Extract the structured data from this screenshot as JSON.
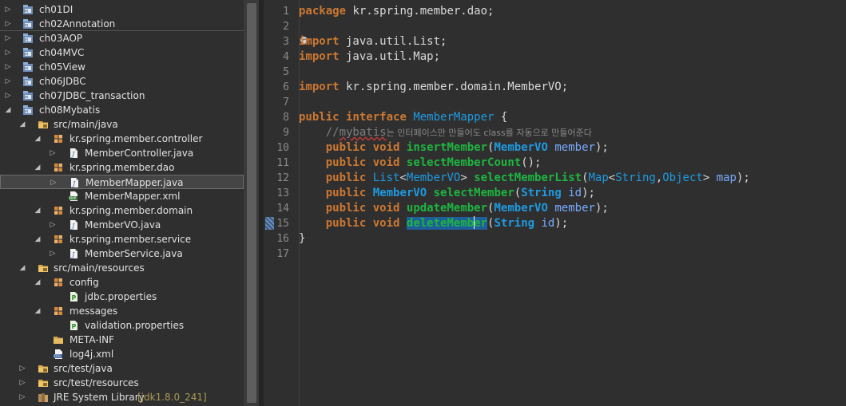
{
  "colors": {
    "background": "#2f2f2f",
    "keyword": "#cc7832",
    "type": "#1e9ae0",
    "method": "#1eb540",
    "param": "#79abff",
    "selection": "#1e5f99",
    "comment": "#7f7f7f"
  },
  "explorer": {
    "items": [
      {
        "label": "ch01DI",
        "icon": "project-icon"
      },
      {
        "label": "ch02Annotation",
        "icon": "project-icon"
      },
      {
        "label": "ch03AOP",
        "icon": "project-icon"
      },
      {
        "label": "ch04MVC",
        "icon": "project-icon"
      },
      {
        "label": "ch05View",
        "icon": "project-icon"
      },
      {
        "label": "ch06JDBC",
        "icon": "project-icon"
      },
      {
        "label": "ch07JDBC_transaction",
        "icon": "project-icon"
      },
      {
        "label": "ch08Mybatis",
        "icon": "project-icon"
      },
      {
        "label": "src/main/java",
        "icon": "source-folder-icon"
      },
      {
        "label": "kr.spring.member.controller",
        "icon": "package-icon"
      },
      {
        "label": "MemberController.java",
        "icon": "java-file-icon"
      },
      {
        "label": "kr.spring.member.dao",
        "icon": "package-icon"
      },
      {
        "label": "MemberMapper.java",
        "icon": "java-file-icon"
      },
      {
        "label": "MemberMapper.xml",
        "icon": "xml-file-icon"
      },
      {
        "label": "kr.spring.member.domain",
        "icon": "package-icon"
      },
      {
        "label": "MemberVO.java",
        "icon": "java-file-icon"
      },
      {
        "label": "kr.spring.member.service",
        "icon": "package-icon"
      },
      {
        "label": "MemberService.java",
        "icon": "java-file-icon"
      },
      {
        "label": "src/main/resources",
        "icon": "source-folder-icon"
      },
      {
        "label": "config",
        "icon": "package-icon"
      },
      {
        "label": "jdbc.properties",
        "icon": "properties-file-icon"
      },
      {
        "label": "messages",
        "icon": "package-icon"
      },
      {
        "label": "validation.properties",
        "icon": "properties-file-icon"
      },
      {
        "label": "META-INF",
        "icon": "folder-icon"
      },
      {
        "label": "log4j.xml",
        "icon": "config-xml-icon"
      },
      {
        "label": "src/test/java",
        "icon": "source-folder-icon"
      },
      {
        "label": "src/test/resources",
        "icon": "source-folder-icon"
      },
      {
        "label": "JRE System Library",
        "decoration": "[jdk1.8.0_241]",
        "icon": "library-icon"
      }
    ]
  },
  "editor": {
    "line_numbers": [
      "1",
      "2",
      "3",
      "4",
      "5",
      "6",
      "7",
      "8",
      "9",
      "10",
      "11",
      "12",
      "13",
      "14",
      "15",
      "16",
      "17"
    ],
    "fold_marker": "−",
    "code": {
      "l1": {
        "kw": "package",
        "rest": " kr.spring.member.dao;"
      },
      "l3": {
        "kw": "import",
        "rest": " java.util.List;"
      },
      "l4": {
        "kw": "import",
        "rest": " java.util.Map;"
      },
      "l6": {
        "kw": "import",
        "rest": " kr.spring.member.domain.MemberVO;"
      },
      "l8": {
        "kw1": "public",
        "kw2": "interface",
        "name": "MemberMapper",
        "brace": " {"
      },
      "l9": {
        "slashes": "//",
        "word": "mybatis",
        "text": "는 인터페이스만 만들어도 class를 자동으로 만들어준다"
      },
      "l10": {
        "kw1": "public",
        "kw2": "void",
        "method": "insertMember",
        "open": "(",
        "type": "MemberVO",
        "param": "member",
        "close": ");"
      },
      "l11": {
        "kw1": "public",
        "kw2": "void",
        "method": "selectMemberCount",
        "close": "();"
      },
      "l12": {
        "kw1": "public",
        "type1": "List",
        "lt": "<",
        "type2": "MemberVO",
        "gt": ">",
        "method": "selectMemberList",
        "open": "(",
        "type3": "Map",
        "lt2": "<",
        "type4": "String",
        "comma": ",",
        "type5": "Object",
        "gt2": ">",
        "param": "map",
        "close": ");"
      },
      "l13": {
        "kw1": "public",
        "type": "MemberVO",
        "method": "selectMember",
        "open": "(",
        "ptype": "String",
        "param": "id",
        "close": ");"
      },
      "l14": {
        "kw1": "public",
        "kw2": "void",
        "method": "updateMember",
        "open": "(",
        "type": "MemberVO",
        "param": "member",
        "close": ");"
      },
      "l15": {
        "kw1": "public",
        "kw2": "void",
        "method_a": "deleteMemb",
        "method_b": "er",
        "open": "(",
        "ptype": "String",
        "param": "id",
        "close": ");"
      },
      "l16": {
        "brace": "}"
      }
    }
  }
}
